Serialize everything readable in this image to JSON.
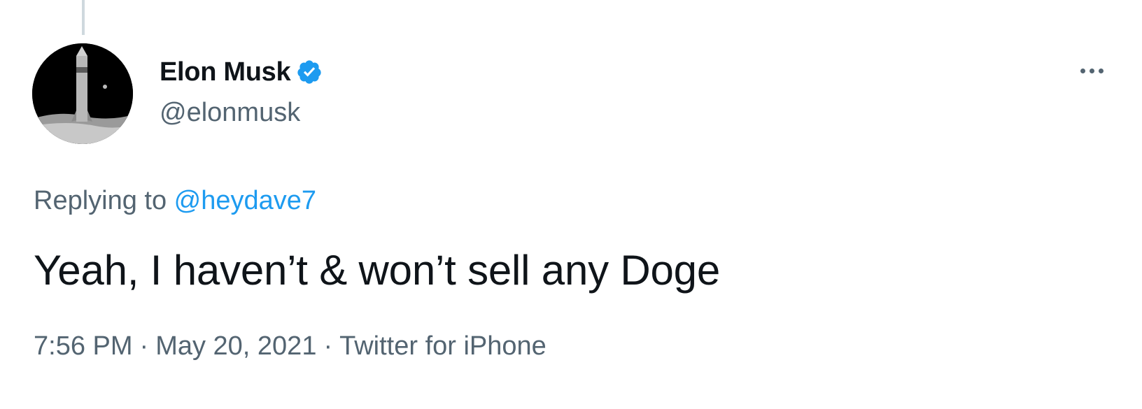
{
  "tweet": {
    "author": {
      "display_name": "Elon Musk",
      "handle": "@elonmusk",
      "verified": true,
      "avatar_icon": "starship-on-moon-avatar"
    },
    "reply_context": {
      "prefix": "Replying to ",
      "mention": "@heydave7"
    },
    "text": "Yeah, I haven’t & won’t sell any Doge",
    "meta": {
      "time": "7:56 PM",
      "separator": "·",
      "date": "May 20, 2021",
      "source": "Twitter for iPhone"
    },
    "more_icon": "more-options-icon"
  },
  "colors": {
    "primary_text": "#0f1419",
    "secondary_text": "#536471",
    "link": "#1d9bf0",
    "verified": "#1d9bf0",
    "thread_line": "#cfd9de"
  }
}
